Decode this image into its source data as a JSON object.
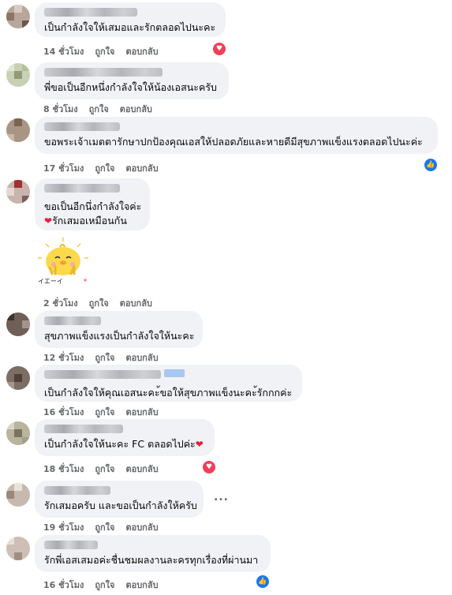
{
  "comments": [
    {
      "text": "เป็นกำลังใจให้เสมอและรักตลอดไปนะคะ",
      "time": "14 ชั่วโมง",
      "like": "ถูกใจ",
      "reply": "ตอบกลับ",
      "reaction": "love-icon"
    },
    {
      "text": "พี่ขอเป็นอีกหนึ่งกำลังใจให้น้องเอสนะครับ",
      "time": "8 ชั่วโมง",
      "like": "ถูกใจ",
      "reply": "ตอบกลับ"
    },
    {
      "text": "ขอพระเจ้าเมตตารักษาปกป้องคุณเอสให้ปลอดภัยและหายดีมีสุขภาพแข็งแรงตลอดไปนะค่ะ",
      "time": "17 ชั่วโมง",
      "like": "ถูกใจ",
      "reply": "ตอบกลับ",
      "reaction": "like-icon"
    },
    {
      "text": "ขอเป็นอีกนึ่งกำลังใจค่ะ",
      "text2": "รักเสมอเหมือนกัน",
      "time": "2 ชั่วโมง",
      "like": "ถูกใจ",
      "reply": "ตอบกลับ",
      "sticker_text": "イエーイ"
    },
    {
      "text": "สุขภาพแข็งแรงเป็นกำลังใจให้นะคะ",
      "time": "12 ชั่วโมง",
      "like": "ถูกใจ",
      "reply": "ตอบกลับ"
    },
    {
      "text": "เป็นกำลังใจให้คุณเอสนะคะ้ขอให้สุขภาพแข็งนะคะ้รักกกค่ะ",
      "time": "16 ชั่วโมง",
      "like": "ถูกใจ",
      "reply": "ตอบกลับ"
    },
    {
      "text": "เป็นกำลังใจให้นะคะ FC ตลอดไปค่ะ",
      "time": "18 ชั่วโมง",
      "like": "ถูกใจ",
      "reply": "ตอบกลับ",
      "reaction": "love-icon"
    },
    {
      "text": "รักเสมอครับ และขอเป็นกำลังให้ครับ",
      "time": "19 ชั่วโมง",
      "like": "ถูกใจ",
      "reply": "ตอบกลับ",
      "more": "..."
    },
    {
      "text": "รักพี่เอสเสมอค่ะชื่นชมผลงานละครทุกเรื่องที่ผ่านมา",
      "time": "16 ชั่วโมง",
      "like": "ถูกใจ",
      "reply": "ตอบกลับ",
      "reaction": "like-icon"
    }
  ],
  "colors": {
    "bubble": "#f0f2f5",
    "action": "#65676b",
    "love": "#f33e58",
    "like": "#1877f2"
  }
}
